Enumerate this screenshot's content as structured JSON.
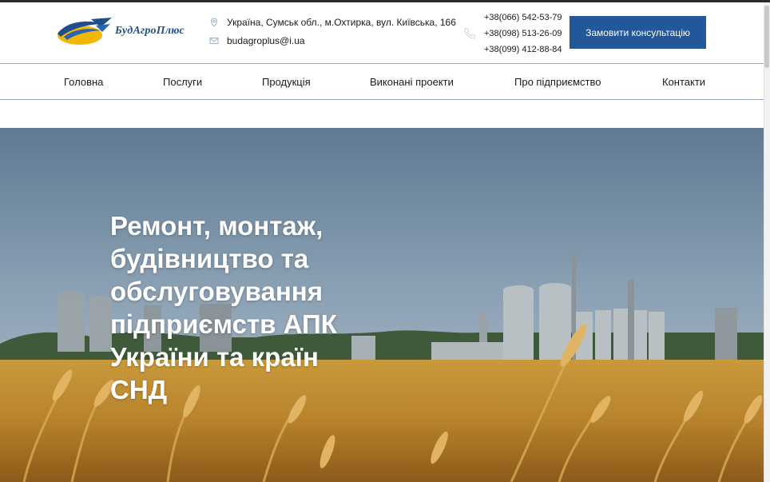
{
  "brand": {
    "name": "БудАгроПлюс",
    "colors": {
      "primary": "#22579a",
      "accent": "#f2b705"
    }
  },
  "header": {
    "address": "Україна, Сумськ обл., м.Охтирка, вул. Київська, 166",
    "email": "budagroplus@i.ua",
    "phones": [
      "+38(066) 542-53-79",
      "+38(098) 513-26-09",
      "+38(099) 412-88-84"
    ],
    "cta_label": "Замовити консультацію",
    "icons": {
      "address": "map-pin-icon",
      "email": "envelope-icon",
      "phone": "phone-icon"
    }
  },
  "nav": {
    "items": [
      {
        "label": "Головна"
      },
      {
        "label": "Послуги"
      },
      {
        "label": "Продукція"
      },
      {
        "label": "Виконані проекти"
      },
      {
        "label": "Про підприємство"
      },
      {
        "label": "Контакти"
      }
    ]
  },
  "hero": {
    "lines": [
      "Ремонт, монтаж,",
      "будівництво та",
      "обслуговування",
      "підприємств АПК",
      "України та країн",
      "СНД"
    ]
  }
}
